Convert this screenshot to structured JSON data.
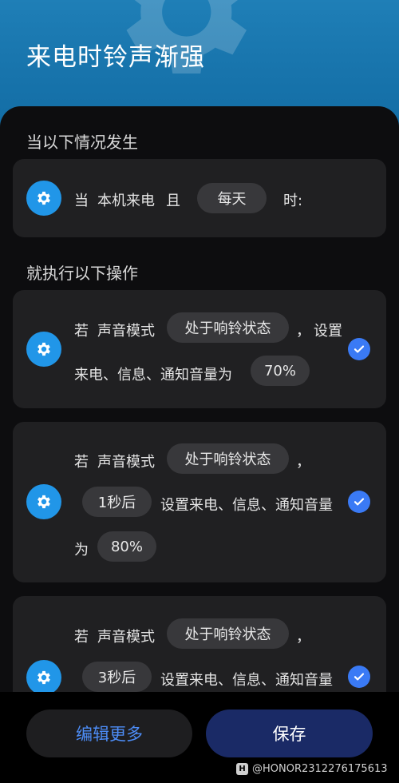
{
  "header": {
    "title": "来电时铃声渐强"
  },
  "trigger": {
    "section_label": "当以下情况发生",
    "when": "当",
    "event": "本机来电",
    "and": "且",
    "schedule_chip": "每天",
    "time_suffix": "时:"
  },
  "actions": {
    "section_label": "就执行以下操作",
    "items": [
      {
        "if_label": "若",
        "condition_label": "声音模式",
        "condition_chip": "处于响铃状态",
        "comma": "，",
        "set_label": "设置",
        "target_label": "来电、信息、通知音量为",
        "value_chip": "70%",
        "checked": true
      },
      {
        "if_label": "若",
        "condition_label": "声音模式",
        "condition_chip": "处于响铃状态",
        "comma": "，",
        "delay_chip": "1秒后",
        "target_label": "设置来电、信息、通知音量",
        "to_label": "为",
        "value_chip": "80%",
        "checked": true
      },
      {
        "if_label": "若",
        "condition_label": "声音模式",
        "condition_chip": "处于响铃状态",
        "comma": "，",
        "delay_chip": "3秒后",
        "target_label": "设置来电、信息、通知音量",
        "checked": true
      }
    ]
  },
  "footer": {
    "edit_more_label": "编辑更多",
    "save_label": "保存"
  },
  "watermark": {
    "logo_letter": "H",
    "text": "@HONOR2312276175613"
  },
  "colors": {
    "header_blue": "#1976ae",
    "gear_blue": "#2196e8",
    "check_blue": "#3a7af5",
    "save_button": "#1a2a66",
    "edit_more_text": "#4d8df7"
  },
  "icons": [
    "gear-icon",
    "check-icon"
  ]
}
